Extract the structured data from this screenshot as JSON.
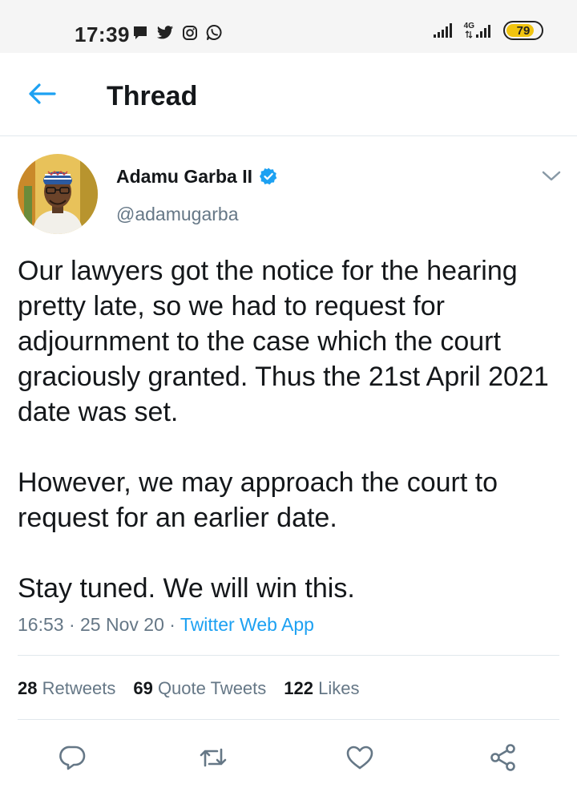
{
  "status_bar": {
    "time": "17:39",
    "battery": "79",
    "network_label": "4G",
    "notification_icons": [
      "message-icon",
      "twitter-bird-icon",
      "instagram-icon",
      "whatsapp-icon"
    ]
  },
  "header": {
    "title": "Thread",
    "back_icon": "back-arrow-icon"
  },
  "tweet": {
    "author_name": "Adamu Garba II",
    "handle": "@adamugarba",
    "verified": true,
    "paragraphs": [
      "Our lawyers got the notice for the hearing pretty late, so we had to request for adjournment to the case which the court graciously granted. Thus the 21st April 2021 date was set.",
      "However, we may approach the court to request for an earlier date.",
      "Stay tuned. We will win this."
    ],
    "time": "16:53",
    "date": "25 Nov 20",
    "separator": "·",
    "source": "Twitter Web App"
  },
  "stats": {
    "retweets_count": "28",
    "retweets_label": "Retweets",
    "quotes_count": "69",
    "quotes_label": "Quote Tweets",
    "likes_count": "122",
    "likes_label": "Likes"
  },
  "actions": [
    "reply-icon",
    "retweet-icon",
    "like-icon",
    "share-icon"
  ],
  "colors": {
    "accent": "#1da1f2",
    "secondary_text": "#657786",
    "primary_text": "#14171a",
    "divider": "#e1e8ed",
    "status_bar_bg": "#f5f5f5",
    "battery_fill": "#f1c40f"
  }
}
